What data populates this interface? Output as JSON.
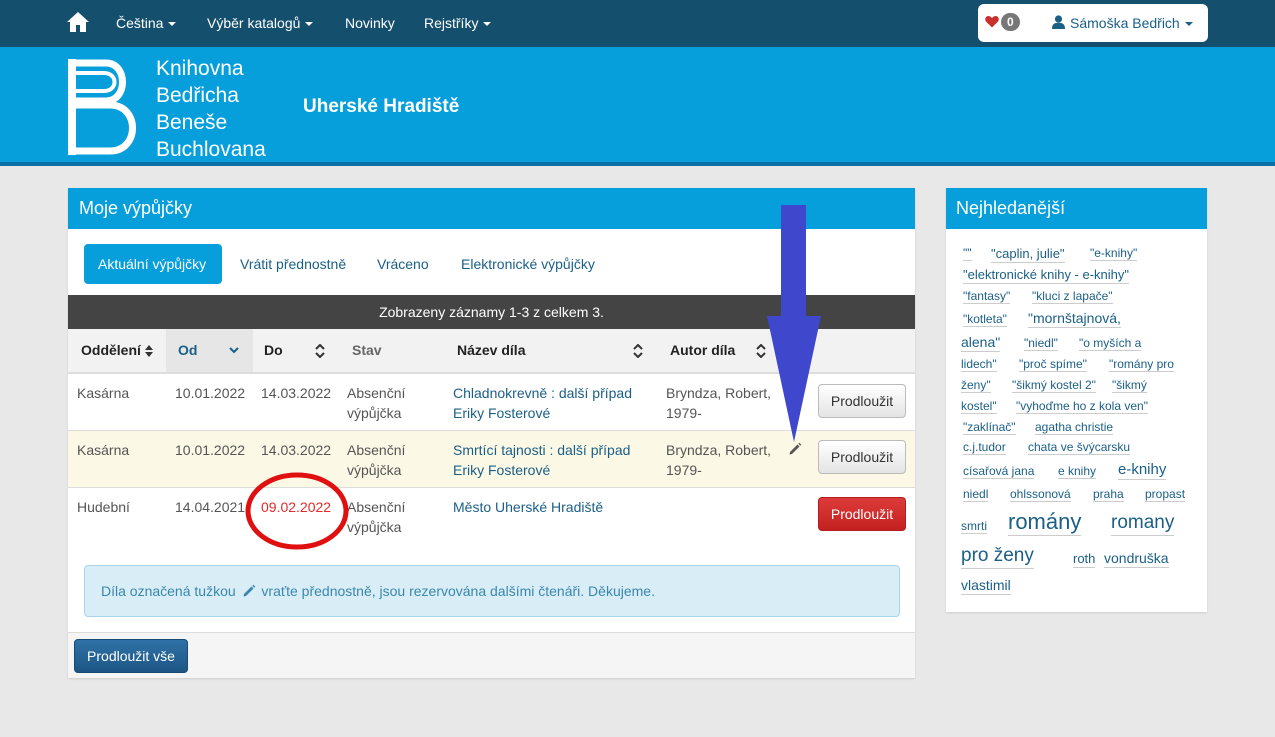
{
  "topnav": {
    "items": [
      {
        "label": "Čeština",
        "dropdown": true
      },
      {
        "label": "Výběr katalogů",
        "dropdown": true
      },
      {
        "label": "Novinky",
        "dropdown": false
      },
      {
        "label": "Rejstříky",
        "dropdown": true
      }
    ],
    "favorites_count": "0",
    "user_name": "Sámoška Bedřich"
  },
  "header": {
    "logo_lines": [
      "Knihovna",
      "Bedřicha",
      "Beneše",
      "Buchlovana"
    ],
    "site_title": "Uherské Hradiště"
  },
  "panel": {
    "title": "Moje výpůjčky",
    "tabs": [
      "Aktuální výpůjčky",
      "Vrátit přednostně",
      "Vráceno",
      "Elektronické výpůjčky"
    ],
    "records_info": "Zobrazeny záznamy 1-3 z celkem 3.",
    "columns": [
      "Oddělení",
      "Od",
      "Do",
      "Stav",
      "Název díla",
      "Autor díla"
    ],
    "rows": [
      {
        "department": "Kasárna",
        "from": "10.01.2022",
        "to": "14.03.2022",
        "status": "Absenční výpůjčka",
        "title": "Chladnokrevně : další případ Eriky Fosterové",
        "author": "Bryndza, Robert, 1979-",
        "button": "Prodloužit"
      },
      {
        "department": "Kasárna",
        "from": "10.01.2022",
        "to": "14.03.2022",
        "status": "Absenční výpůjčka",
        "title": "Smrtící tajnosti : další případ Eriky Fosterové",
        "author": "Bryndza, Robert, 1979-",
        "button": "Prodloužit"
      },
      {
        "department": "Hudební",
        "from": "14.04.2021",
        "to": "09.02.2022",
        "status": "Absenční výpůjčka",
        "title": "Město Uherské Hradiště",
        "author": "",
        "button": "Prodloužit"
      }
    ],
    "alert_before": "Díla označená tužkou",
    "alert_after": "vraťte přednostně, jsou rezervována dalšími čtenáři. Děkujeme.",
    "extend_all": "Prodloužit vše"
  },
  "widget": {
    "title": "Nejhledanější",
    "tags": [
      "\"\"",
      "\"caplin, julie\"",
      "\"e-knihy\"",
      "\"elektronické knihy - e-knihy\"",
      "\"fantasy\"",
      "\"kluci z lapače\"",
      "\"kotleta\"",
      "\"mornštajnová,",
      "alena\"",
      "\"niedl\"",
      "\"o myších a",
      "lidech\"",
      "\"proč spíme\"",
      "\"romány pro",
      "ženy\"",
      "\"šikmý kostel 2\"",
      "\"šikmý",
      "kostel\"",
      "\"vyhoďme ho z kola ven\"",
      "\"zaklínač\"",
      "agatha christie",
      "c.j.tudor",
      "chata ve švýcarsku",
      "císařová jana",
      "e knihy",
      "e-knihy",
      "niedl",
      "ohlssonová",
      "praha",
      "propast",
      "smrti",
      "romány",
      "romany",
      "pro ženy",
      "roth",
      "vondruška",
      "vlastimil"
    ]
  },
  "colors": {
    "navbar": "#14506e",
    "brand": "#079fdb",
    "link": "#1b5f87",
    "danger": "#d32b2b",
    "annotation_arrow": "#3f48cc",
    "annotation_circle": "#e01010"
  }
}
